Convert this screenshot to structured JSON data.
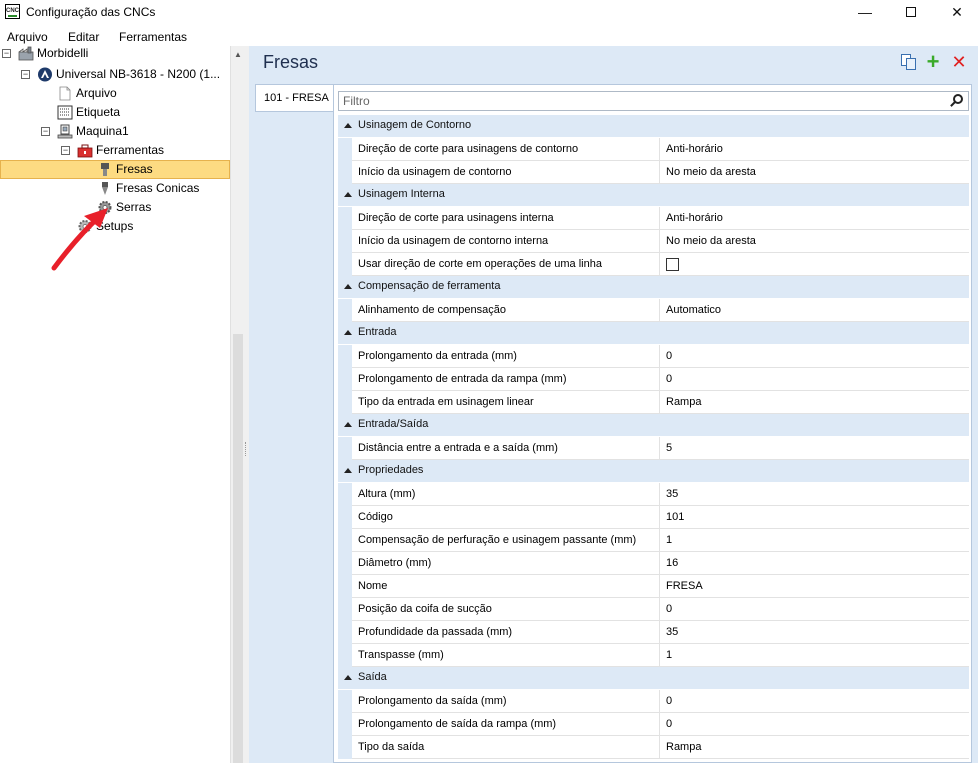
{
  "window": {
    "title": "Configuração das CNCs",
    "app_icon_text": "CNC"
  },
  "menu": [
    "Arquivo",
    "Editar",
    "Ferramentas"
  ],
  "tree": {
    "items": [
      {
        "label": "Morbidelli",
        "icon": "factory-icon"
      },
      {
        "label": "Universal NB-3618 - N200 (1...",
        "icon": "machine-brand-icon"
      },
      {
        "label": "Arquivo",
        "icon": "file-icon"
      },
      {
        "label": "Etiqueta",
        "icon": "label-icon"
      },
      {
        "label": "Maquina1",
        "icon": "machine-icon"
      },
      {
        "label": "Ferramentas",
        "icon": "toolbox-icon"
      },
      {
        "label": "Fresas",
        "icon": "mill-icon",
        "selected": true
      },
      {
        "label": "Fresas Conicas",
        "icon": "conical-mill-icon"
      },
      {
        "label": "Serras",
        "icon": "gear-icon"
      },
      {
        "label": "Setups",
        "icon": "gear-icon"
      }
    ]
  },
  "panel": {
    "title": "Fresas",
    "tab": "101 - FRESA",
    "filter_placeholder": "Filtro"
  },
  "categories": [
    {
      "label": "Usinagem de Contorno",
      "props": [
        {
          "name": "Direção de corte para usinagens de contorno",
          "value": "Anti-horário"
        },
        {
          "name": "Início da usinagem de contorno",
          "value": "No meio da aresta"
        }
      ]
    },
    {
      "label": "Usinagem Interna",
      "props": [
        {
          "name": "Direção de corte para usinagens interna",
          "value": "Anti-horário"
        },
        {
          "name": "Início da usinagem de contorno interna",
          "value": "No meio da aresta"
        },
        {
          "name": "Usar direção de corte em operações de uma linha",
          "value": "",
          "checkbox": true,
          "checked": false
        }
      ]
    },
    {
      "label": "Compensação de ferramenta",
      "props": [
        {
          "name": "Alinhamento de compensação",
          "value": "Automatico"
        }
      ]
    },
    {
      "label": "Entrada",
      "props": [
        {
          "name": "Prolongamento da entrada (mm)",
          "value": "0"
        },
        {
          "name": "Prolongamento de entrada da rampa (mm)",
          "value": "0"
        },
        {
          "name": "Tipo da entrada em usinagem linear",
          "value": "Rampa"
        }
      ]
    },
    {
      "label": "Entrada/Saída",
      "props": [
        {
          "name": "Distância entre a entrada e a saída (mm)",
          "value": "5"
        }
      ]
    },
    {
      "label": "Propriedades",
      "props": [
        {
          "name": "Altura (mm)",
          "value": "35"
        },
        {
          "name": "Código",
          "value": "101"
        },
        {
          "name": "Compensação de perfuração e usinagem passante (mm)",
          "value": "1"
        },
        {
          "name": "Diâmetro (mm)",
          "value": "16"
        },
        {
          "name": "Nome",
          "value": "FRESA"
        },
        {
          "name": "Posição da coifa de sucção",
          "value": "0"
        },
        {
          "name": "Profundidade da passada (mm)",
          "value": "35"
        },
        {
          "name": "Transpasse (mm)",
          "value": "1"
        }
      ]
    },
    {
      "label": "Saída",
      "props": [
        {
          "name": "Prolongamento da saída (mm)",
          "value": "0"
        },
        {
          "name": "Prolongamento de saída da rampa (mm)",
          "value": "0"
        },
        {
          "name": "Tipo da saída",
          "value": "Rampa"
        }
      ]
    }
  ],
  "colors": {
    "accent_panel": "#dde9f6",
    "selection": "#fddb82",
    "annotation_arrow": "#e8202a"
  }
}
